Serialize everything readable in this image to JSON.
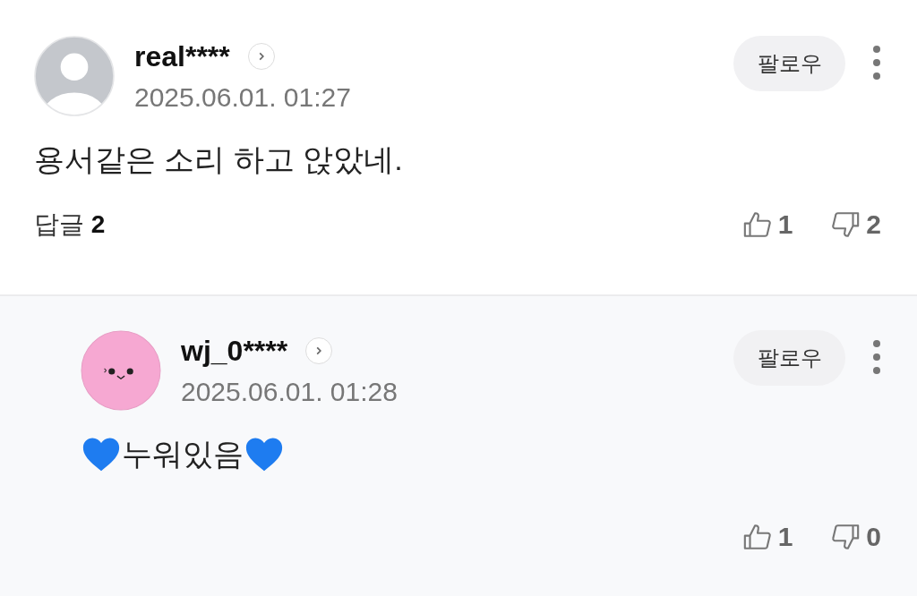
{
  "comments": [
    {
      "kind": "comment",
      "avatar": {
        "kind": "default"
      },
      "username": "real****",
      "date": "2025.06.01. 01:27",
      "follow_label": "팔로우",
      "body": "용서같은 소리 하고 앉았네.",
      "replies_label": "답글",
      "replies_count": "2",
      "likes": "1",
      "dislikes": "2"
    },
    {
      "kind": "reply",
      "avatar": {
        "kind": "pink-face"
      },
      "username": "wj_0****",
      "date": "2025.06.01. 01:28",
      "follow_label": "팔로우",
      "body": "누워있음",
      "hearts": true,
      "likes": "1",
      "dislikes": "0"
    }
  ]
}
